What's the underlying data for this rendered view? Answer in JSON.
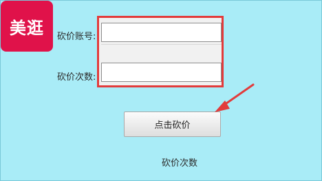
{
  "logo": {
    "text": "美逛"
  },
  "form": {
    "account_label": "砍价账号:",
    "account_value": "",
    "count_label": "砍价次数:",
    "count_value": "",
    "submit_label": "点击砍价"
  },
  "footer": {
    "count_text": "砍价次数"
  },
  "annotations": {
    "highlight_color": "#e23b3b",
    "arrow_icon": "red-arrow-icon"
  },
  "colors": {
    "background": "#a9ecf7",
    "logo_bg": "#e0124a"
  }
}
